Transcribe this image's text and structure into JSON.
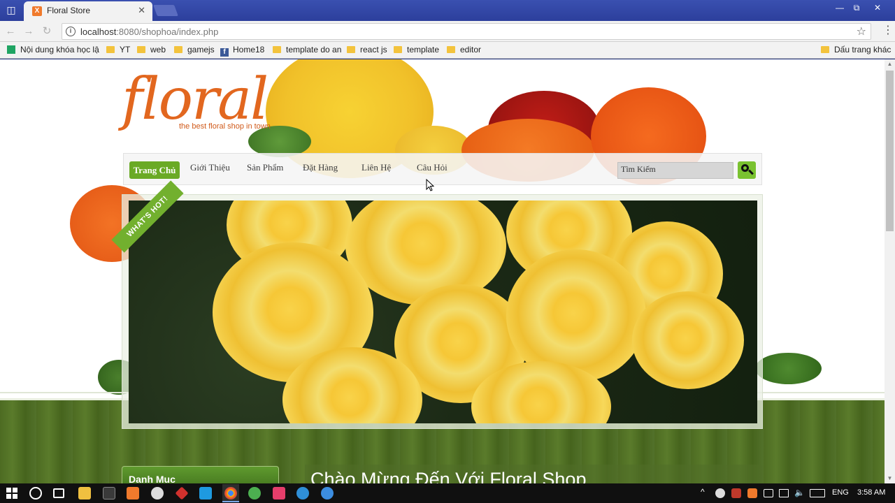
{
  "browser": {
    "tab_title": "Floral Store",
    "tab_favicon": "X",
    "url_host": "localhost",
    "url_rest": ":8080/shophoa/index.php",
    "window_controls": [
      "minimize-icon",
      "restore-icon",
      "close-icon"
    ]
  },
  "bookmarks": {
    "items": [
      {
        "label": "Nội dung khóa học lậ",
        "icon": "sheet-icon"
      },
      {
        "label": "YT",
        "icon": "folder-icon"
      },
      {
        "label": "web",
        "icon": "folder-icon"
      },
      {
        "label": "gamejs",
        "icon": "folder-icon"
      },
      {
        "label": "Home18",
        "icon": "facebook-icon"
      },
      {
        "label": "template do an",
        "icon": "folder-icon"
      },
      {
        "label": "react js",
        "icon": "folder-icon"
      },
      {
        "label": "template",
        "icon": "folder-icon"
      },
      {
        "label": "editor",
        "icon": "folder-icon"
      }
    ],
    "other": "Dấu trang khác"
  },
  "site": {
    "logo_word": "floral",
    "logo_tagline": "the best floral shop in town",
    "nav": {
      "home": "Trang Chủ",
      "items": [
        "Giới Thiệu",
        "Sản Phẩm",
        "Đặt Hàng",
        "Liên Hệ",
        "Câu Hỏi"
      ]
    },
    "search_placeholder": "Tìm Kiếm",
    "ribbon": "WHAT'S HOT!",
    "category_title": "Danh Mục",
    "welcome": "Chào Mừng Đến Với Floral Shop"
  },
  "taskbar": {
    "language": "ENG",
    "time": "3:58 AM"
  },
  "colors": {
    "accent_green": "#6aaa25",
    "logo_orange": "#e2671f",
    "chrome_blue": "#2c3f9c"
  }
}
